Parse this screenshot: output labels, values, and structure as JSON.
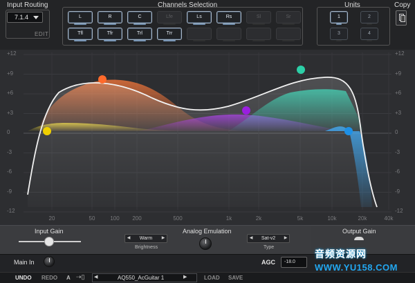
{
  "header": {
    "input_routing": {
      "title": "Input Routing",
      "value": "7.1.4",
      "edit_label": "EDIT"
    },
    "channels": {
      "title": "Channels Selection",
      "row1": [
        {
          "label": "L",
          "state": "on"
        },
        {
          "label": "R",
          "state": "on"
        },
        {
          "label": "C",
          "state": "on"
        },
        {
          "label": "Lfe",
          "state": "off"
        },
        {
          "label": "Ls",
          "state": "on"
        },
        {
          "label": "Rs",
          "state": "on"
        },
        {
          "label": "Sl",
          "state": "off"
        },
        {
          "label": "Sr",
          "state": "off"
        }
      ],
      "row2": [
        {
          "label": "Tfl",
          "state": "on"
        },
        {
          "label": "Tfr",
          "state": "on"
        },
        {
          "label": "Trl",
          "state": "on"
        },
        {
          "label": "Trr",
          "state": "on"
        },
        {
          "label": "",
          "state": "empty"
        },
        {
          "label": "",
          "state": "empty"
        },
        {
          "label": "",
          "state": "empty"
        },
        {
          "label": "",
          "state": "empty"
        }
      ]
    },
    "units": {
      "title": "Units",
      "buttons": [
        "1",
        "2",
        "3",
        "4"
      ],
      "selected": "1"
    },
    "copy": {
      "title": "Copy",
      "icon": "copy-icon"
    }
  },
  "graph": {
    "y_labels": [
      "+12",
      "+9",
      "+6",
      "+3",
      "0",
      "-3",
      "-6",
      "-9",
      "-12"
    ],
    "x_labels": [
      "20",
      "50",
      "100",
      "200",
      "500",
      "1k",
      "2k",
      "5k",
      "10k",
      "20k",
      "40k"
    ],
    "band_colors": {
      "low_shelf": "#ff7a3a",
      "low_mid": "#e8d43a",
      "mid": "#a22be6",
      "high_mid": "#26c7a6",
      "high_shelf": "#2d9be8"
    },
    "band_handles": [
      {
        "name": "band-1-handle",
        "color": "#f0d000"
      },
      {
        "name": "band-2-handle",
        "color": "#ff6a2b"
      },
      {
        "name": "band-3-handle",
        "color": "#9a1fe0"
      },
      {
        "name": "band-4-handle",
        "color": "#2ccfa7"
      },
      {
        "name": "band-5-handle",
        "color": "#1e90e6"
      }
    ]
  },
  "controls": {
    "input_gain": {
      "title": "Input Gain"
    },
    "analog_emulation": {
      "title": "Analog Emulation",
      "brightness": {
        "value": "Warm",
        "label": "Brightness"
      },
      "type": {
        "value": "Sat-v2",
        "label": "Type"
      }
    },
    "output_gain": {
      "title": "Output Gain"
    }
  },
  "bottom": {
    "main_in": "Main In",
    "agc_label": "AGC",
    "agc_value": "-18.0",
    "undo": "UNDO",
    "redo": "REDO",
    "a_label": "A",
    "preset_name": "AQ550_AcGuitar 1",
    "load": "LOAD",
    "save": "SAVE"
  },
  "watermark": {
    "line1": "音频资源网",
    "line2": "WWW.YU158.COM"
  }
}
